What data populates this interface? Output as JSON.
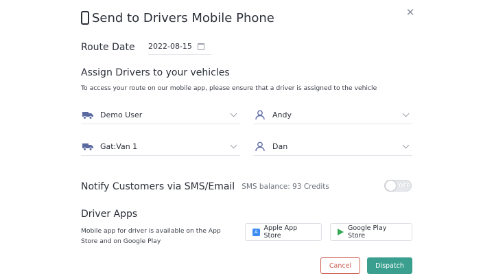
{
  "dialog": {
    "title": "Send to Drivers Mobile Phone",
    "close_icon": "close-icon",
    "title_icon": "mobile-phone-icon"
  },
  "route": {
    "label": "Route Date",
    "date": "2022-08-15",
    "icon": "calendar-icon"
  },
  "assign": {
    "title": "Assign Drivers to your vehicles",
    "subtitle": "To access your route on our mobile app, please ensure that a driver is assigned to the vehicle",
    "rows": [
      {
        "vehicle": "Demo User",
        "driver": "Andy"
      },
      {
        "vehicle": "Gat:Van 1",
        "driver": "Dan"
      }
    ],
    "vehicle_icon": "truck-icon",
    "driver_icon": "user-icon"
  },
  "notify": {
    "title": "Notify Customers via SMS/Email",
    "balance": "SMS balance: 93 Credits",
    "toggle_label": "OFF",
    "toggle_on": false
  },
  "apps": {
    "title": "Driver Apps",
    "description": "Mobile app for driver is available on the App Store and on Google Play",
    "apple_label": "Apple App Store",
    "google_label": "Google Play Store"
  },
  "actions": {
    "cancel": "Cancel",
    "dispatch": "Dispatch"
  },
  "colors": {
    "accent": "#3b9f90",
    "cancel": "#c95e4f",
    "icon": "#5b6aa0"
  }
}
